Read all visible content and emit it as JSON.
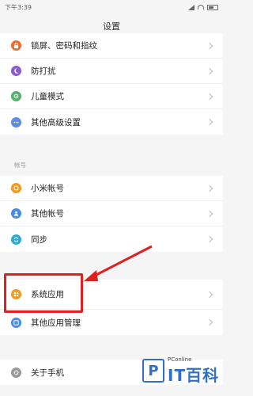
{
  "status_bar": {
    "time": "下午3:39"
  },
  "header": {
    "title": "设置"
  },
  "group1": [
    {
      "label": "锁屏、密码和指纹",
      "icon": "lock-icon",
      "color": "#f06a2a"
    },
    {
      "label": "防打扰",
      "icon": "moon-icon",
      "color": "#8a5bd1"
    },
    {
      "label": "儿童模式",
      "icon": "child-icon",
      "color": "#52b26b"
    },
    {
      "label": "其他高级设置",
      "icon": "dots-icon",
      "color": "#5b8ee6"
    }
  ],
  "section_account": "帐号",
  "group2": [
    {
      "label": "小米帐号",
      "icon": "mi-account-icon",
      "color": "#f39a1e"
    },
    {
      "label": "其他帐号",
      "icon": "person-icon",
      "color": "#4a8be8"
    },
    {
      "label": "同步",
      "icon": "sync-icon",
      "color": "#31a9d8"
    }
  ],
  "group3": [
    {
      "label": "系统应用",
      "icon": "grid-icon",
      "color": "#f39a1e"
    },
    {
      "label": "其他应用管理",
      "icon": "apps-icon",
      "color": "#4a8be8"
    }
  ],
  "group4": [
    {
      "label": "关于手机",
      "icon": "info-icon",
      "color": "#9a9a9a"
    }
  ],
  "logo": {
    "brand_small": "PConline",
    "brand_big": "IT百科",
    "mark": "P"
  },
  "colors": {
    "highlight": "#e02020"
  }
}
